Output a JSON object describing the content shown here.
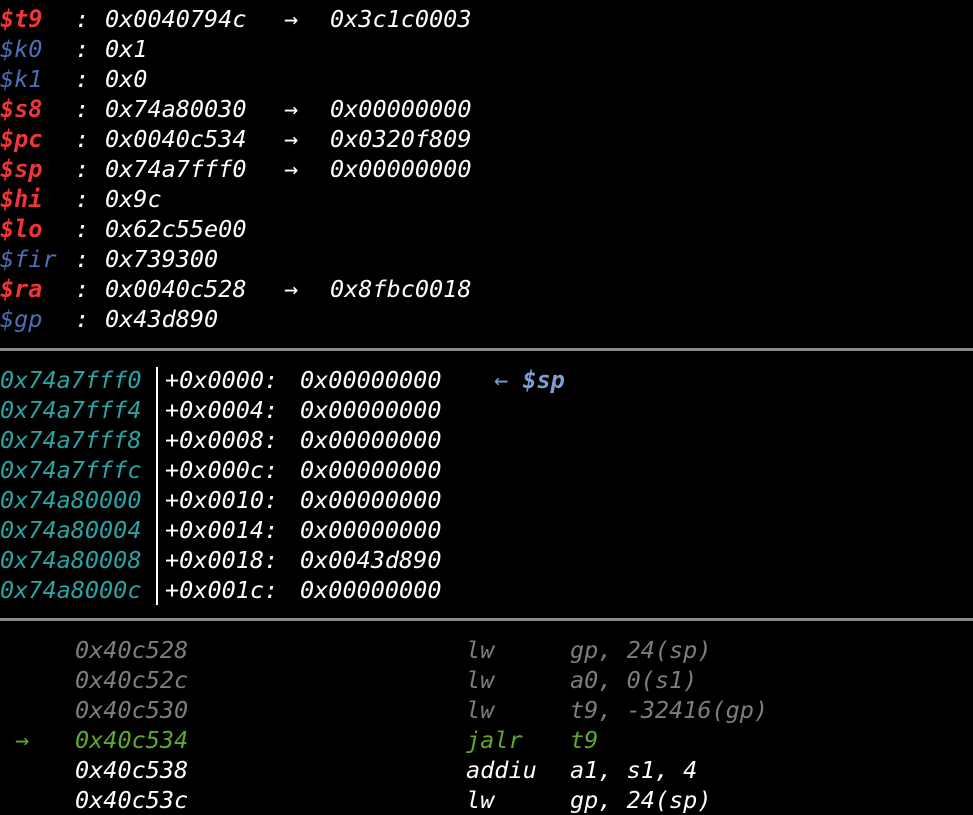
{
  "registers": [
    {
      "name": "$t9",
      "value": "0x0040794c",
      "arrow": "→",
      "target": "0x3c1c0003",
      "changed": true
    },
    {
      "name": "$k0",
      "value": "0x1",
      "arrow": "",
      "target": "",
      "changed": false
    },
    {
      "name": "$k1",
      "value": "0x0",
      "arrow": "",
      "target": "",
      "changed": false
    },
    {
      "name": "$s8",
      "value": "0x74a80030",
      "arrow": "→",
      "target": "0x00000000",
      "changed": true
    },
    {
      "name": "$pc",
      "value": "0x0040c534",
      "arrow": "→",
      "target": "0x0320f809",
      "changed": true
    },
    {
      "name": "$sp",
      "value": "0x74a7fff0",
      "arrow": "→",
      "target": "0x00000000",
      "changed": true
    },
    {
      "name": "$hi",
      "value": "0x9c",
      "arrow": "",
      "target": "",
      "changed": true
    },
    {
      "name": "$lo",
      "value": "0x62c55e00",
      "arrow": "",
      "target": "",
      "changed": true
    },
    {
      "name": "$fir",
      "value": "0x739300",
      "arrow": "",
      "target": "",
      "changed": false
    },
    {
      "name": "$ra",
      "value": "0x0040c528",
      "arrow": "→",
      "target": "0x8fbc0018",
      "changed": true
    },
    {
      "name": "$gp",
      "value": "0x43d890",
      "arrow": "",
      "target": "",
      "changed": false
    }
  ],
  "register_colon": ":",
  "stack": [
    {
      "addr": "0x74a7fff0",
      "offset": "+0x0000:",
      "value": "0x00000000",
      "arrow": "←",
      "note": "$sp"
    },
    {
      "addr": "0x74a7fff4",
      "offset": "+0x0004:",
      "value": "0x00000000",
      "arrow": "",
      "note": ""
    },
    {
      "addr": "0x74a7fff8",
      "offset": "+0x0008:",
      "value": "0x00000000",
      "arrow": "",
      "note": ""
    },
    {
      "addr": "0x74a7fffc",
      "offset": "+0x000c:",
      "value": "0x00000000",
      "arrow": "",
      "note": ""
    },
    {
      "addr": "0x74a80000",
      "offset": "+0x0010:",
      "value": "0x00000000",
      "arrow": "",
      "note": ""
    },
    {
      "addr": "0x74a80004",
      "offset": "+0x0014:",
      "value": "0x00000000",
      "arrow": "",
      "note": ""
    },
    {
      "addr": "0x74a80008",
      "offset": "+0x0018:",
      "value": "0x0043d890",
      "arrow": "",
      "note": ""
    },
    {
      "addr": "0x74a8000c",
      "offset": "+0x001c:",
      "value": "0x00000000",
      "arrow": "",
      "note": ""
    }
  ],
  "disassembly": [
    {
      "marker": "",
      "addr": "0x40c528",
      "mnemonic": "lw",
      "operands": "gp, 24(sp)",
      "state": "past"
    },
    {
      "marker": "",
      "addr": "0x40c52c",
      "mnemonic": "lw",
      "operands": "a0, 0(s1)",
      "state": "past"
    },
    {
      "marker": "",
      "addr": "0x40c530",
      "mnemonic": "lw",
      "operands": "t9, -32416(gp)",
      "state": "past"
    },
    {
      "marker": "→",
      "addr": "0x40c534",
      "mnemonic": "jalr",
      "operands": "t9",
      "state": "current"
    },
    {
      "marker": "",
      "addr": "0x40c538",
      "mnemonic": "addiu",
      "operands": "a1, s1, 4",
      "state": "future"
    },
    {
      "marker": "",
      "addr": "0x40c53c",
      "mnemonic": "lw",
      "operands": "gp, 24(sp)",
      "state": "future"
    }
  ],
  "colors": {
    "changed_register": "#ef3535",
    "plain_register": "#4f6fb3",
    "stack_address": "#2aa3a3",
    "stack_note": "#7b9fd6",
    "current_instruction": "#5fa82f",
    "past_instruction": "#7d7d7d",
    "separator": "#8a8a8a"
  }
}
